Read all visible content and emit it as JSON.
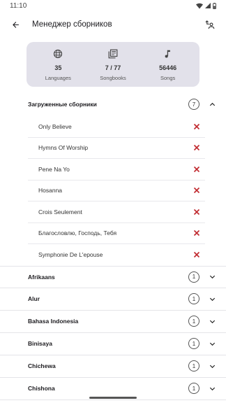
{
  "status_bar": {
    "time": "11:10"
  },
  "app_bar": {
    "title": "Менеджер сборников"
  },
  "stats": [
    {
      "icon": "globe-icon",
      "value": "35",
      "label": "Languages"
    },
    {
      "icon": "songbooks-icon",
      "value": "7 / 77",
      "label": "Songbooks"
    },
    {
      "icon": "music-note-icon",
      "value": "56446",
      "label": "Songs"
    }
  ],
  "downloaded": {
    "title": "Загруженные сборники",
    "count": "7",
    "items": [
      "Only Believe",
      "Hymns Of Worship",
      "Pene Na Yo",
      "Hosanna",
      "Crois Seulement",
      "Благословлю, Господь, Тебя",
      "Symphonie De L'epouse"
    ]
  },
  "languages": [
    {
      "name": "Afrikaans",
      "count": "1"
    },
    {
      "name": "Alur",
      "count": "1"
    },
    {
      "name": "Bahasa Indonesia",
      "count": "1"
    },
    {
      "name": "Binisaya",
      "count": "1"
    },
    {
      "name": "Chichewa",
      "count": "1"
    },
    {
      "name": "Chishona",
      "count": "1"
    }
  ],
  "colors": {
    "accent_remove": "#c0282d",
    "card_bg": "#e2e1ea"
  }
}
